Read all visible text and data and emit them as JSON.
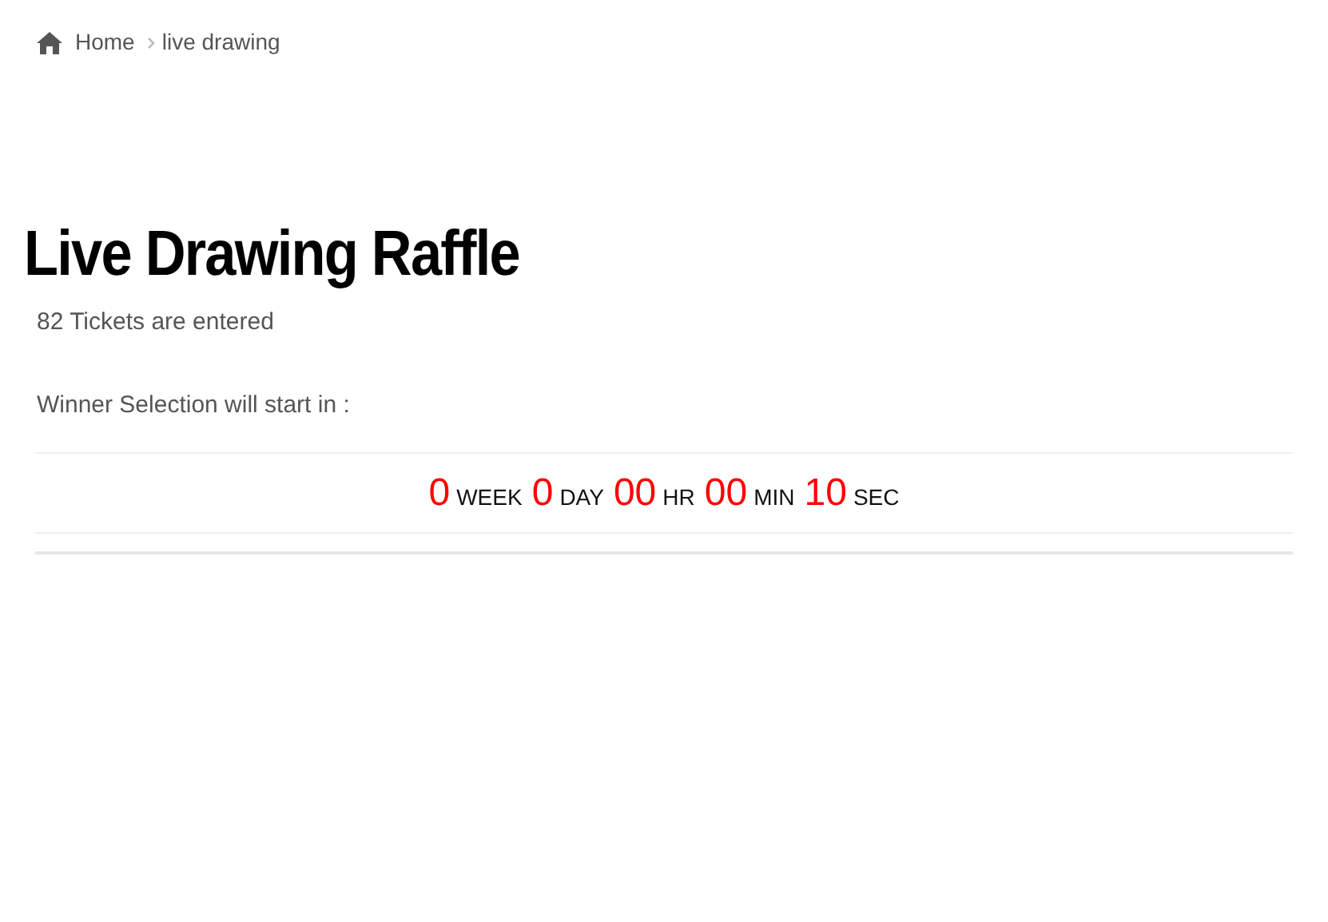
{
  "breadcrumb": [
    {
      "label": "Home"
    },
    {
      "label": "live drawing"
    }
  ],
  "title": "Live Drawing Raffle",
  "tickets": "82 Tickets are entered",
  "countdown_label": "Winner Selection will start in :",
  "countdown": [
    {
      "value": "0",
      "unit": "WEEK"
    },
    {
      "value": "0",
      "unit": "DAY"
    },
    {
      "value": "00",
      "unit": "HR"
    },
    {
      "value": "00",
      "unit": "MIN"
    },
    {
      "value": "10",
      "unit": "SEC"
    }
  ]
}
